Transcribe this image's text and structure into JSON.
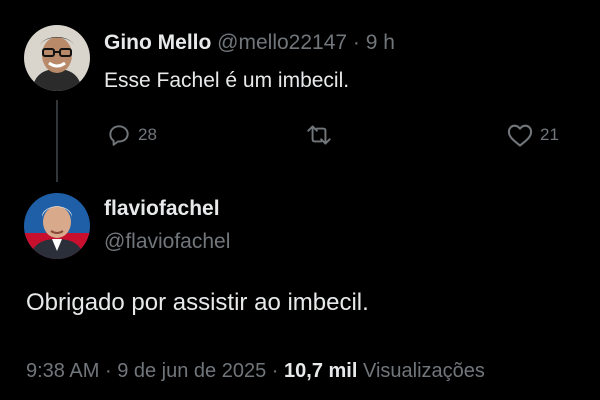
{
  "reply": {
    "display_name": "Gino Mello",
    "handle": "@mello22147",
    "separator": "·",
    "time_ago": "9 h",
    "text": "Esse Fachel é um imbecil.",
    "replies_count": "28",
    "likes_count": "21"
  },
  "main_tweet": {
    "display_name": "flaviofachel",
    "handle": "@flaviofachel",
    "text": "Obrigado por assistir ao imbecil.",
    "time": "9:38 AM",
    "separator": "·",
    "date": "9 de jun de 2025",
    "views_count": "10,7 mil",
    "views_label": "Visualizações"
  },
  "icons": {
    "reply": "comment-bubble-icon",
    "retweet": "retweet-icon",
    "like": "heart-icon"
  },
  "colors": {
    "background": "#000000",
    "primary_text": "#e7e9ea",
    "secondary_text": "#71767b",
    "thread_line": "#333639"
  }
}
